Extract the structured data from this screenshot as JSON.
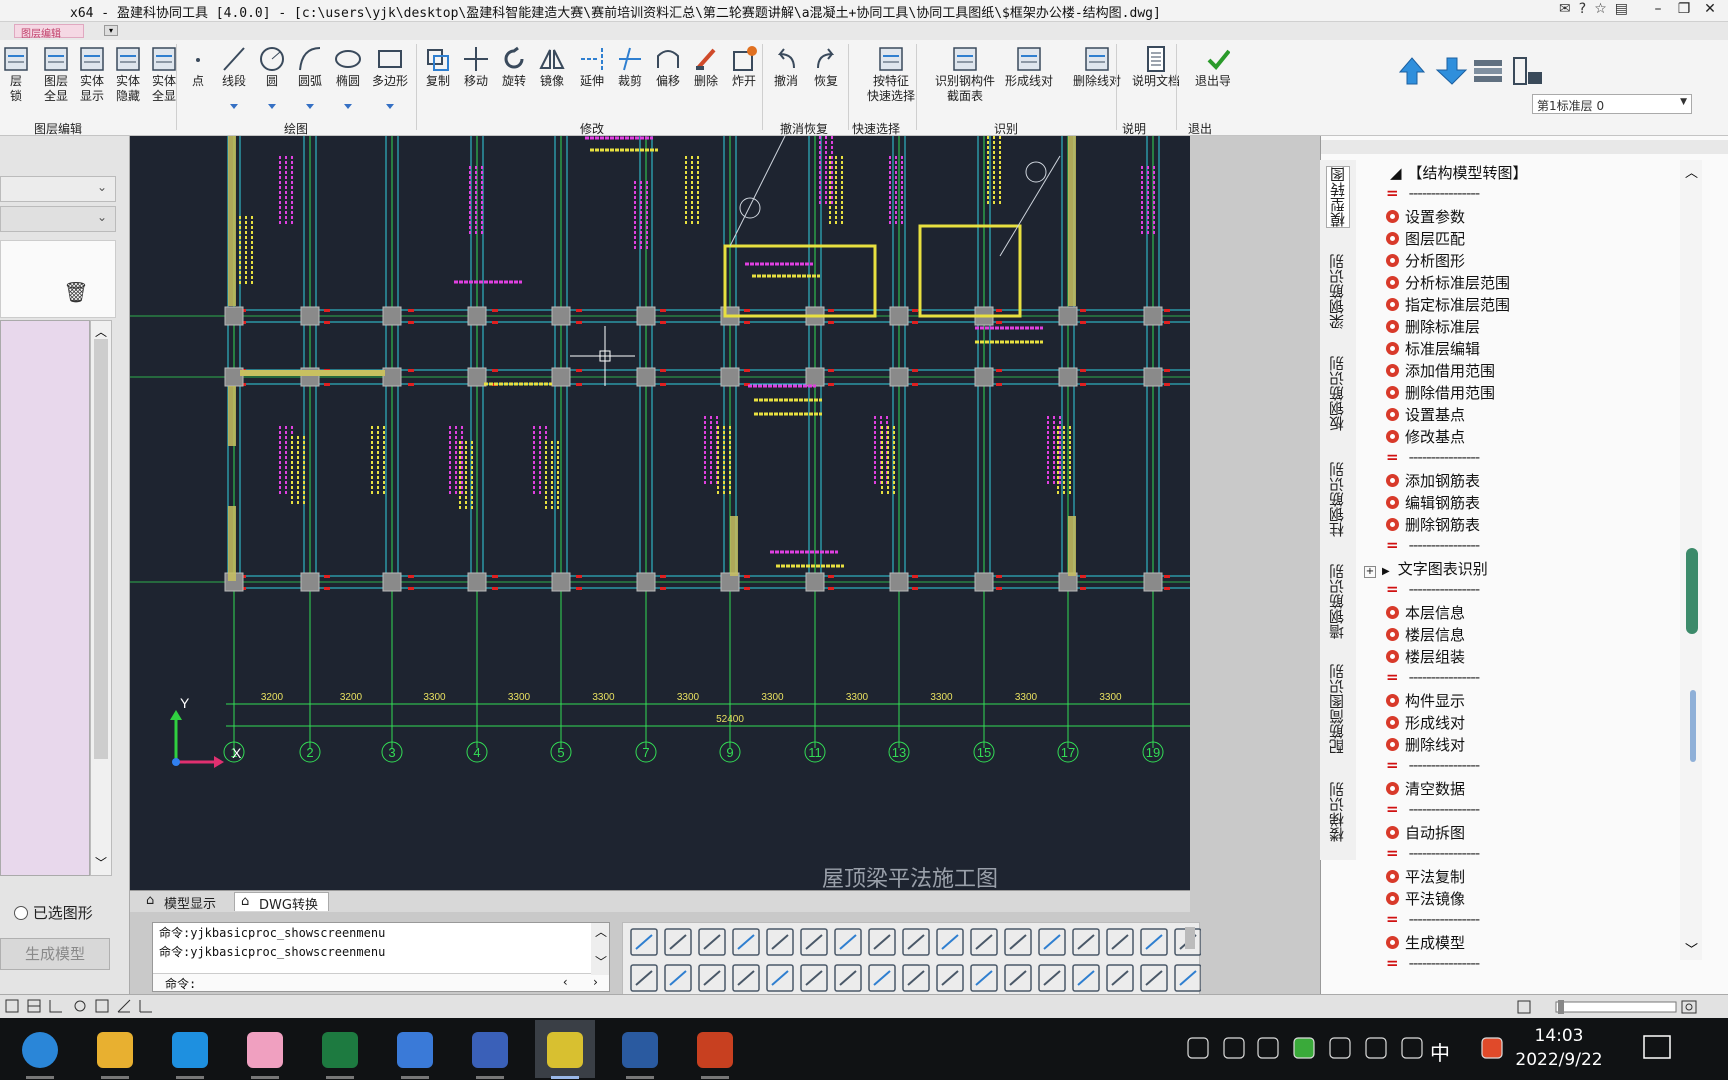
{
  "window": {
    "title": "x64 - 盈建科协同工具 [4.0.0] - [c:\\users\\yjk\\desktop\\盈建科智能建造大赛\\赛前培训资料汇总\\第二轮赛题讲解\\a混凝土+协同工具\\协同工具图纸\\$框架办公楼-结构图.dwg]",
    "qat_tab": "图层编辑"
  },
  "ribbon": {
    "tools": [
      {
        "label": "层\n锁",
        "icon": "layer-lock-icon"
      },
      {
        "label": "图层\n全显",
        "icon": "layer-showall-icon"
      },
      {
        "label": "实体\n显示",
        "icon": "entity-show-icon"
      },
      {
        "label": "实体\n隐藏",
        "icon": "entity-hide-icon"
      },
      {
        "label": "实体\n全显",
        "icon": "entity-showall-icon"
      },
      {
        "label": "点",
        "icon": "point-icon"
      },
      {
        "label": "线段",
        "icon": "line-icon"
      },
      {
        "label": "圆",
        "icon": "circle-icon"
      },
      {
        "label": "圆弧",
        "icon": "arc-icon"
      },
      {
        "label": "椭圆",
        "icon": "ellipse-icon"
      },
      {
        "label": "多边形",
        "icon": "polygon-icon"
      },
      {
        "label": "复制",
        "icon": "copy-icon"
      },
      {
        "label": "移动",
        "icon": "move-icon"
      },
      {
        "label": "旋转",
        "icon": "rotate-icon"
      },
      {
        "label": "镜像",
        "icon": "mirror-icon"
      },
      {
        "label": "延伸",
        "icon": "extend-icon"
      },
      {
        "label": "裁剪",
        "icon": "trim-icon"
      },
      {
        "label": "偏移",
        "icon": "offset-icon"
      },
      {
        "label": "删除",
        "icon": "delete-icon"
      },
      {
        "label": "炸开",
        "icon": "explode-icon"
      },
      {
        "label": "撤消",
        "icon": "undo-icon"
      },
      {
        "label": "恢复",
        "icon": "redo-icon"
      },
      {
        "label": "按特征\n快速选择",
        "icon": "quick-select-icon"
      },
      {
        "label": "识别钢构件\n截面表",
        "icon": "steel-section-icon"
      },
      {
        "label": "形成线对",
        "icon": "form-linepair-icon"
      },
      {
        "label": "删除线对",
        "icon": "delete-linepair-icon"
      },
      {
        "label": "说明文档",
        "icon": "document-icon"
      },
      {
        "label": "退出导图",
        "icon": "exit-check-icon"
      }
    ],
    "groups": [
      "图层编辑",
      "绘图",
      "修改",
      "撤消恢复",
      "快速选择",
      "识别",
      "说明",
      "退出"
    ],
    "floor_select": "第1标准层 0"
  },
  "left_panel": {
    "radio_label": "已选图形",
    "generate_button": "生成模型"
  },
  "canvas": {
    "axis_labels": [
      "1",
      "2",
      "3",
      "4",
      "5",
      "7",
      "9",
      "11",
      "13",
      "15",
      "17",
      "19"
    ],
    "dims": [
      "3200",
      "3200",
      "3300",
      "3300",
      "3300",
      "3300",
      "3300",
      "3300",
      "3300",
      "3300",
      "3300"
    ],
    "total_dim": "52400",
    "drawing_title": "屋顶梁平法施工图",
    "ucs_y": "Y",
    "ucs_x": "X"
  },
  "cad_tabs": [
    "模型显示",
    "DWG转换"
  ],
  "command": {
    "lines": [
      "命令:yjkbasicproc_showscreenmenu",
      "命令:yjkbasicproc_showscreenmenu"
    ],
    "prompt": "命令:"
  },
  "right_panel": {
    "vtabs": [
      "模型转图",
      "梁钢筋识别",
      "板钢筋识别",
      "柱钢筋识别",
      "墙钢筋识别",
      "配筋简图识别",
      "楼梯识别"
    ],
    "tree_root": "【结构模型转图】",
    "tree": [
      {
        "t": "sep"
      },
      {
        "t": "item",
        "label": "设置参数"
      },
      {
        "t": "item",
        "label": "图层匹配"
      },
      {
        "t": "item",
        "label": "分析图形"
      },
      {
        "t": "item",
        "label": "分析标准层范围"
      },
      {
        "t": "item",
        "label": "指定标准层范围"
      },
      {
        "t": "item",
        "label": "删除标准层"
      },
      {
        "t": "item",
        "label": "标准层编辑"
      },
      {
        "t": "item",
        "label": "添加借用范围"
      },
      {
        "t": "item",
        "label": "删除借用范围"
      },
      {
        "t": "item",
        "label": "设置基点"
      },
      {
        "t": "item",
        "label": "修改基点"
      },
      {
        "t": "sep"
      },
      {
        "t": "item",
        "label": "添加钢筋表"
      },
      {
        "t": "item",
        "label": "编辑钢筋表"
      },
      {
        "t": "item",
        "label": "删除钢筋表"
      },
      {
        "t": "sep"
      },
      {
        "t": "folder",
        "label": "文字图表识别"
      },
      {
        "t": "sep"
      },
      {
        "t": "item",
        "label": "本层信息"
      },
      {
        "t": "item",
        "label": "楼层信息"
      },
      {
        "t": "item",
        "label": "楼层组装"
      },
      {
        "t": "sep"
      },
      {
        "t": "item",
        "label": "构件显示"
      },
      {
        "t": "item",
        "label": "形成线对"
      },
      {
        "t": "item",
        "label": "删除线对"
      },
      {
        "t": "sep"
      },
      {
        "t": "item",
        "label": "清空数据"
      },
      {
        "t": "sep"
      },
      {
        "t": "item",
        "label": "自动拆图"
      },
      {
        "t": "sep"
      },
      {
        "t": "item",
        "label": "平法复制"
      },
      {
        "t": "item",
        "label": "平法镜像"
      },
      {
        "t": "sep"
      },
      {
        "t": "item",
        "label": "生成模型"
      },
      {
        "t": "sep"
      }
    ]
  },
  "taskbar": {
    "apps": [
      "edge-icon",
      "folder-icon",
      "ie-icon",
      "meeting-icon",
      "excel-icon",
      "photos-icon",
      "yjk-icon",
      "yjk-active-icon",
      "cad-icon",
      "powerpoint-icon"
    ],
    "time": "14:03",
    "date": "2022/9/22",
    "ime": "中"
  },
  "colors": {
    "canvas_bg": "#1e2430",
    "cad_cyan": "#33d1e0",
    "cad_green": "#33dd55",
    "cad_yellow": "#e8e040",
    "cad_magenta": "#e040e0",
    "cad_red": "#e02020"
  }
}
